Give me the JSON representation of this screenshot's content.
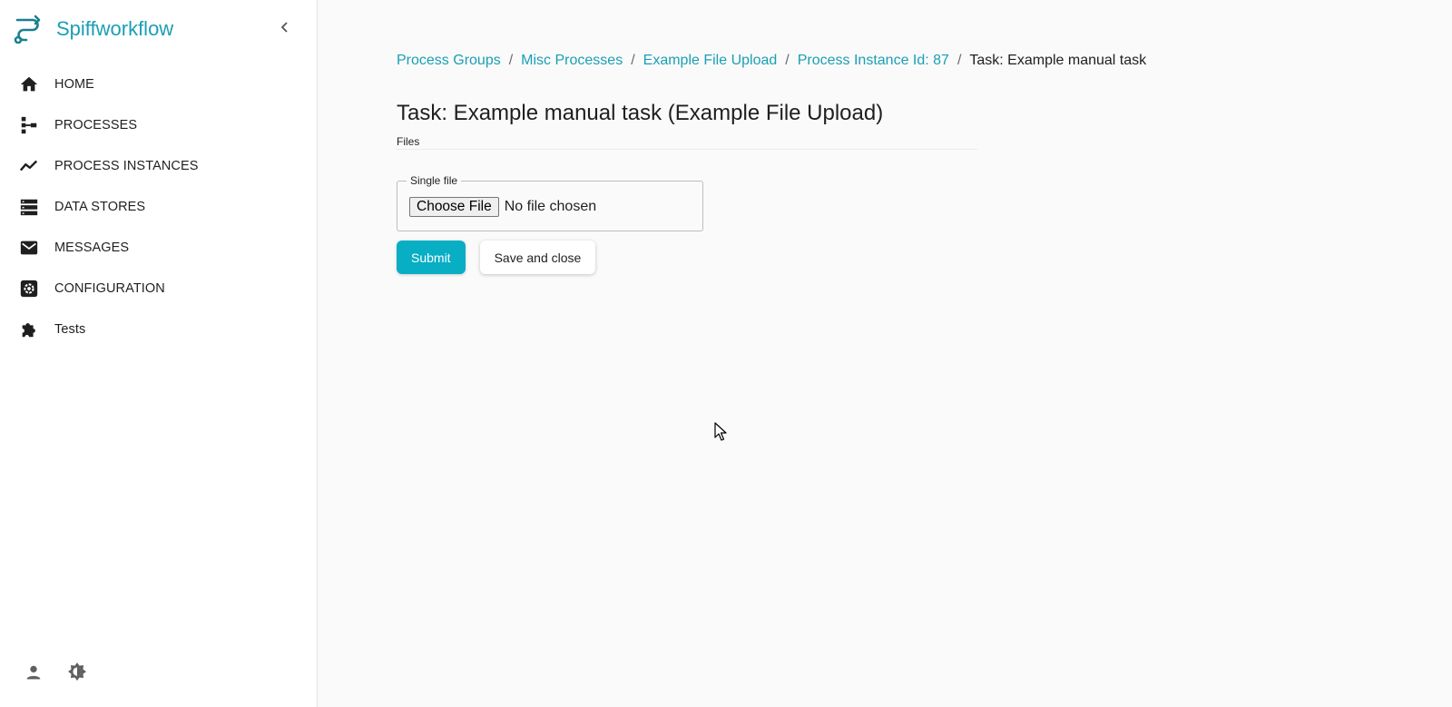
{
  "brand": {
    "name": "Spiffworkflow",
    "accent_color": "#1a9fb4"
  },
  "sidebar": {
    "collapse_icon": "chevron-left-icon",
    "items": [
      {
        "label": "HOME",
        "icon": "home-icon"
      },
      {
        "label": "PROCESSES",
        "icon": "process-tree-icon"
      },
      {
        "label": "PROCESS INSTANCES",
        "icon": "trend-line-icon"
      },
      {
        "label": "DATA STORES",
        "icon": "data-store-icon"
      },
      {
        "label": "MESSAGES",
        "icon": "mail-icon"
      },
      {
        "label": "CONFIGURATION",
        "icon": "settings-icon"
      },
      {
        "label": "Tests",
        "icon": "puzzle-icon"
      }
    ],
    "footer": [
      {
        "icon": "user-icon"
      },
      {
        "icon": "theme-toggle-icon"
      }
    ]
  },
  "breadcrumb": {
    "links": [
      "Process Groups",
      "Misc Processes",
      "Example File Upload",
      "Process Instance Id: 87"
    ],
    "separator": "/",
    "current": "Task: Example manual task"
  },
  "task": {
    "title": "Task: Example manual task (Example File Upload)",
    "section": "Files",
    "field": {
      "legend": "Single file",
      "button_label": "Choose File",
      "status": "No file chosen"
    },
    "actions": {
      "submit_label": "Submit",
      "save_label": "Save and close"
    }
  },
  "colors": {
    "primary": "#07aec4",
    "background": "#fafafa"
  }
}
